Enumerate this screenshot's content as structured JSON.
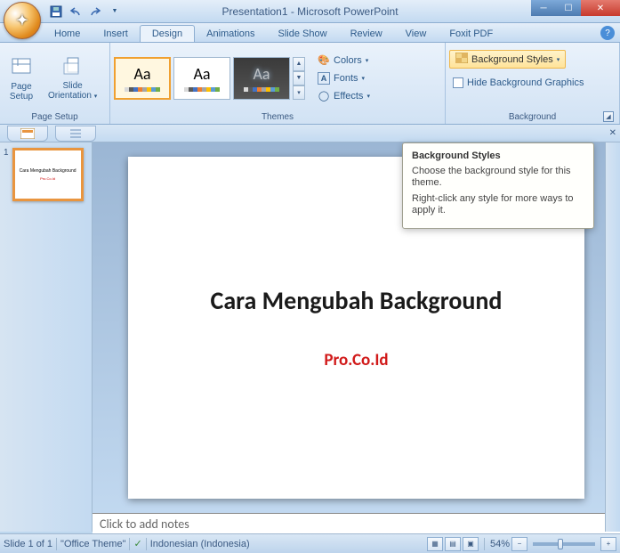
{
  "title": "Presentation1 - Microsoft PowerPoint",
  "tabs": [
    "Home",
    "Insert",
    "Design",
    "Animations",
    "Slide Show",
    "Review",
    "View",
    "Foxit PDF"
  ],
  "active_tab": "Design",
  "ribbon": {
    "page_setup": {
      "label": "Page Setup",
      "page_setup_btn": "Page\nSetup",
      "orientation_btn": "Slide\nOrientation"
    },
    "themes": {
      "label": "Themes",
      "aa": "Aa",
      "colors": "Colors",
      "fonts": "Fonts",
      "effects": "Effects"
    },
    "background": {
      "label": "Background",
      "bg_styles": "Background Styles",
      "hide_graphics": "Hide Background Graphics"
    }
  },
  "tooltip": {
    "title": "Background Styles",
    "line1": "Choose the background style for this theme.",
    "line2": "Right-click any style for more ways to apply it."
  },
  "slide": {
    "title": "Cara Mengubah Background",
    "subtitle": "Pro.Co.Id"
  },
  "notes_placeholder": "Click to add notes",
  "status": {
    "slide": "Slide 1 of 1",
    "theme": "\"Office Theme\"",
    "language": "Indonesian (Indonesia)",
    "zoom": "54%"
  },
  "thumb_num": "1",
  "theme_palette": [
    "#d9d9d9",
    "#5a5a5a",
    "#4472c4",
    "#ed7d31",
    "#a5a5a5",
    "#ffc000",
    "#5b9bd5",
    "#70ad47"
  ]
}
